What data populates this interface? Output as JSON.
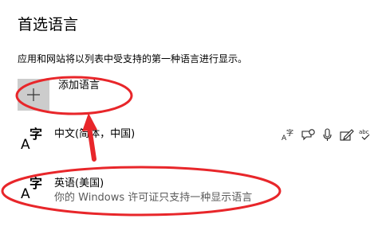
{
  "page": {
    "title": "首选语言",
    "description": "应用和网站将以列表中受支持的第一种语言进行显示。"
  },
  "add_language": {
    "label": "添加语言",
    "icon": "plus-icon"
  },
  "languages": [
    {
      "name": "中文(简体，中国)",
      "icon_text": {
        "a": "A",
        "zi": "字"
      },
      "features": [
        {
          "icon": "language-pack-icon",
          "glyph": "A字"
        },
        {
          "icon": "speech-bubble-icon"
        },
        {
          "icon": "microphone-icon"
        },
        {
          "icon": "handwriting-icon"
        },
        {
          "icon": "spellcheck-icon",
          "glyph": "abc"
        }
      ]
    },
    {
      "name": "英语(美国)",
      "subtitle": "你的 Windows 许可证只支持一种显示语言",
      "icon_text": {
        "a": "A",
        "zi": "字"
      }
    }
  ],
  "colors": {
    "annotation_red": "#e8262a",
    "tile_gray": "#cccccc",
    "subtitle_gray": "#5a5a5a"
  }
}
